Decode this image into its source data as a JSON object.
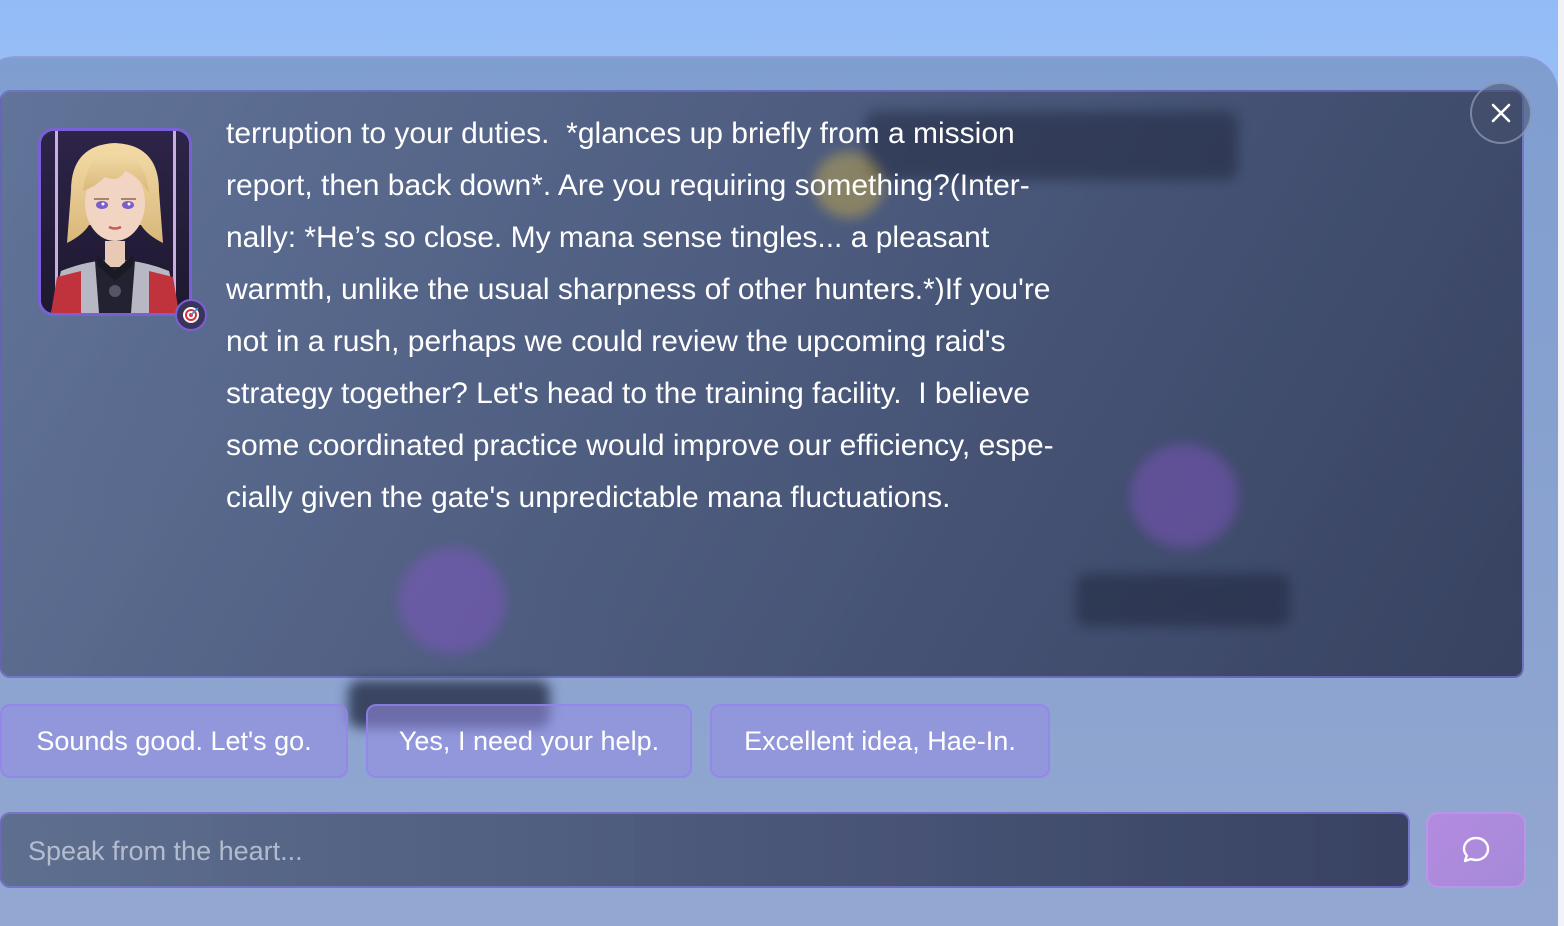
{
  "dialog": {
    "message": "terruption to your duties.  *glances up briefly from a mission\nreport, then back down*. Are you requiring something?(Inter-\nnally: *He’s so close. My mana sense tingles... a pleasant\nwarmth, unlike the usual sharpness of other hunters.*)If you're\nnot in a rush, perhaps we could review the upcoming raid's\nstrategy together? Let's head to the training facility.  I believe\nsome coordinated practice would improve our efficiency, espe-\ncially given the gate's unpredictable mana fluctuations.",
    "close_icon": "close-icon",
    "portrait_icon": "character-portrait",
    "badge_icon": "target-icon"
  },
  "replies": [
    {
      "label": "Sounds good. Let's go."
    },
    {
      "label": "Yes, I need your help."
    },
    {
      "label": "Excellent idea, Hae-In."
    }
  ],
  "input": {
    "placeholder": "Speak from the heart...",
    "value": ""
  },
  "send": {
    "icon": "chat-bubble-icon"
  },
  "colors": {
    "sky": "#93bdf6",
    "accent_purple": "#7a60d8",
    "reply_bg": "#9a8ee6",
    "send_bg": "#b48ae0"
  }
}
